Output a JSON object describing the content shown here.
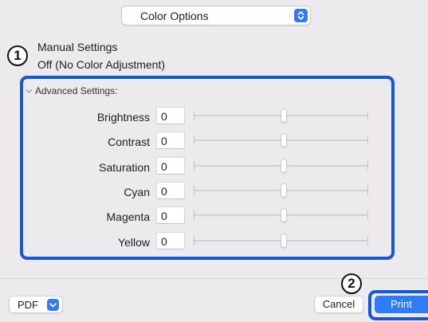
{
  "color_options_popup": {
    "label": "Color Options"
  },
  "callouts": {
    "one": "1",
    "two": "2"
  },
  "manual_settings": {
    "title": "Manual Settings",
    "value": "Off (No Color Adjustment)"
  },
  "advanced": {
    "header": "Advanced Settings:",
    "rows": [
      {
        "label": "Brightness",
        "value": "0",
        "level": 0.5
      },
      {
        "label": "Contrast",
        "value": "0",
        "level": 0.5
      },
      {
        "label": "Saturation",
        "value": "0",
        "level": 0.5
      },
      {
        "label": "Cyan",
        "value": "0",
        "level": 0.5
      },
      {
        "label": "Magenta",
        "value": "0",
        "level": 0.5
      },
      {
        "label": "Yellow",
        "value": "0",
        "level": 0.5
      }
    ]
  },
  "footer": {
    "pdf_label": "PDF",
    "cancel_label": "Cancel",
    "print_label": "Print"
  },
  "colors": {
    "accent": "#2f7cf6",
    "highlight": "#1657d4",
    "background": "#eceaec"
  },
  "icons": {
    "popup_arrows": "up-down-chevron-icon",
    "pdf_arrow": "chevron-down-icon",
    "disclosure": "chevron-down-icon"
  }
}
